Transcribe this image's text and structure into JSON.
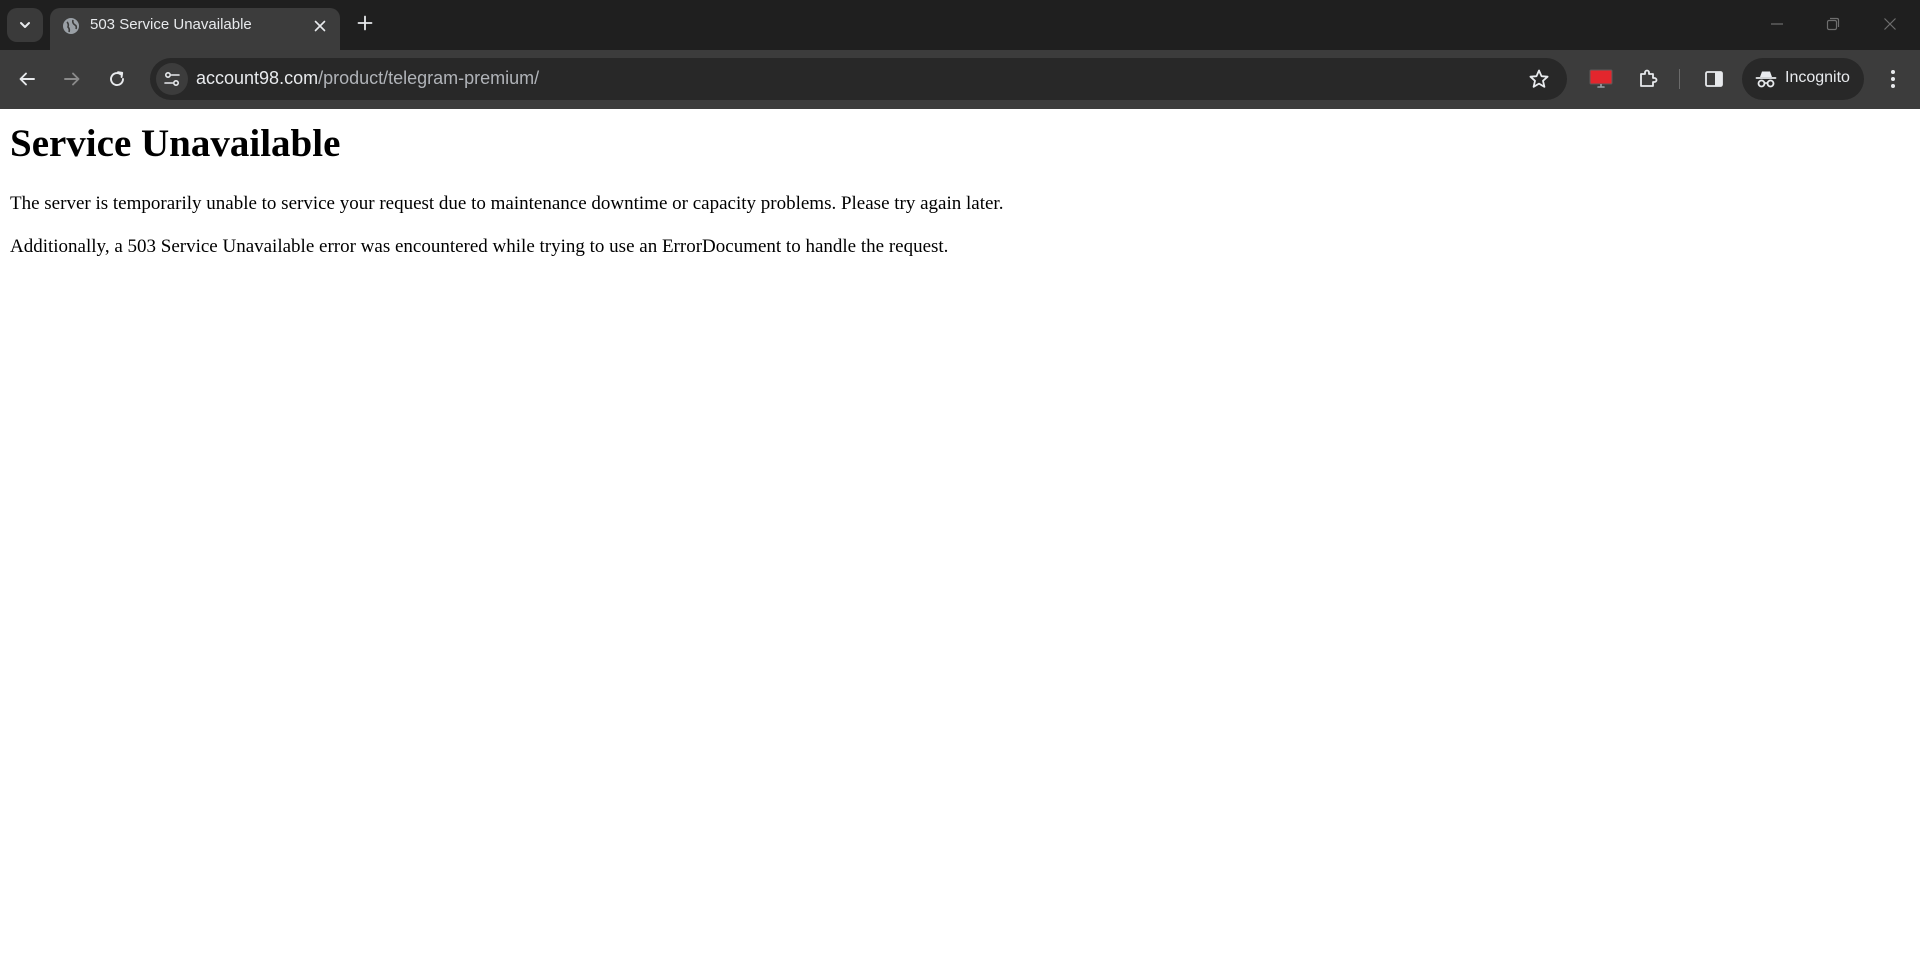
{
  "browser": {
    "tab": {
      "title": "503 Service Unavailable"
    },
    "address_bar": {
      "host": "account98.com",
      "path": "/product/telegram-premium/"
    },
    "profile": {
      "label": "Incognito"
    },
    "colors": {
      "tabstrip": "#1f1f1f",
      "toolbar": "#3c3c3c",
      "omnibox": "#282828",
      "extension_accent": "#e3262d"
    }
  },
  "page": {
    "heading": "Service Unavailable",
    "paragraphs": [
      "The server is temporarily unable to service your request due to maintenance downtime or capacity problems. Please try again later.",
      "Additionally, a 503 Service Unavailable error was encountered while trying to use an ErrorDocument to handle the request."
    ]
  }
}
